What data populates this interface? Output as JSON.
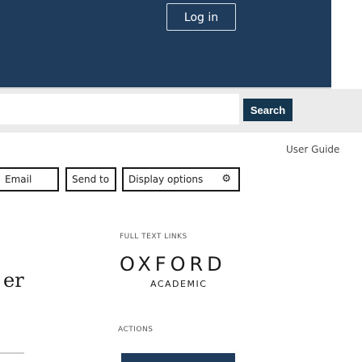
{
  "header": {
    "login_label": "Log in"
  },
  "search": {
    "button_label": "Search",
    "placeholder": ""
  },
  "nav": {
    "user_guide": "User Guide"
  },
  "toolbar": {
    "email_label": "Email",
    "send_to_label": "Send to",
    "display_options_label": "Display options",
    "display_options_icon": "gear-icon"
  },
  "links": {
    "heading": "FULL TEXT LINKS",
    "publisher_name": "OXFORD",
    "publisher_sub": "ACADEMIC"
  },
  "actions": {
    "heading": "ACTIONS"
  },
  "partial_text": "er",
  "colors": {
    "header_bg": "#1f3c5c",
    "search_button_bg": "#14364f",
    "searchbar_bg": "#ebebeb"
  }
}
